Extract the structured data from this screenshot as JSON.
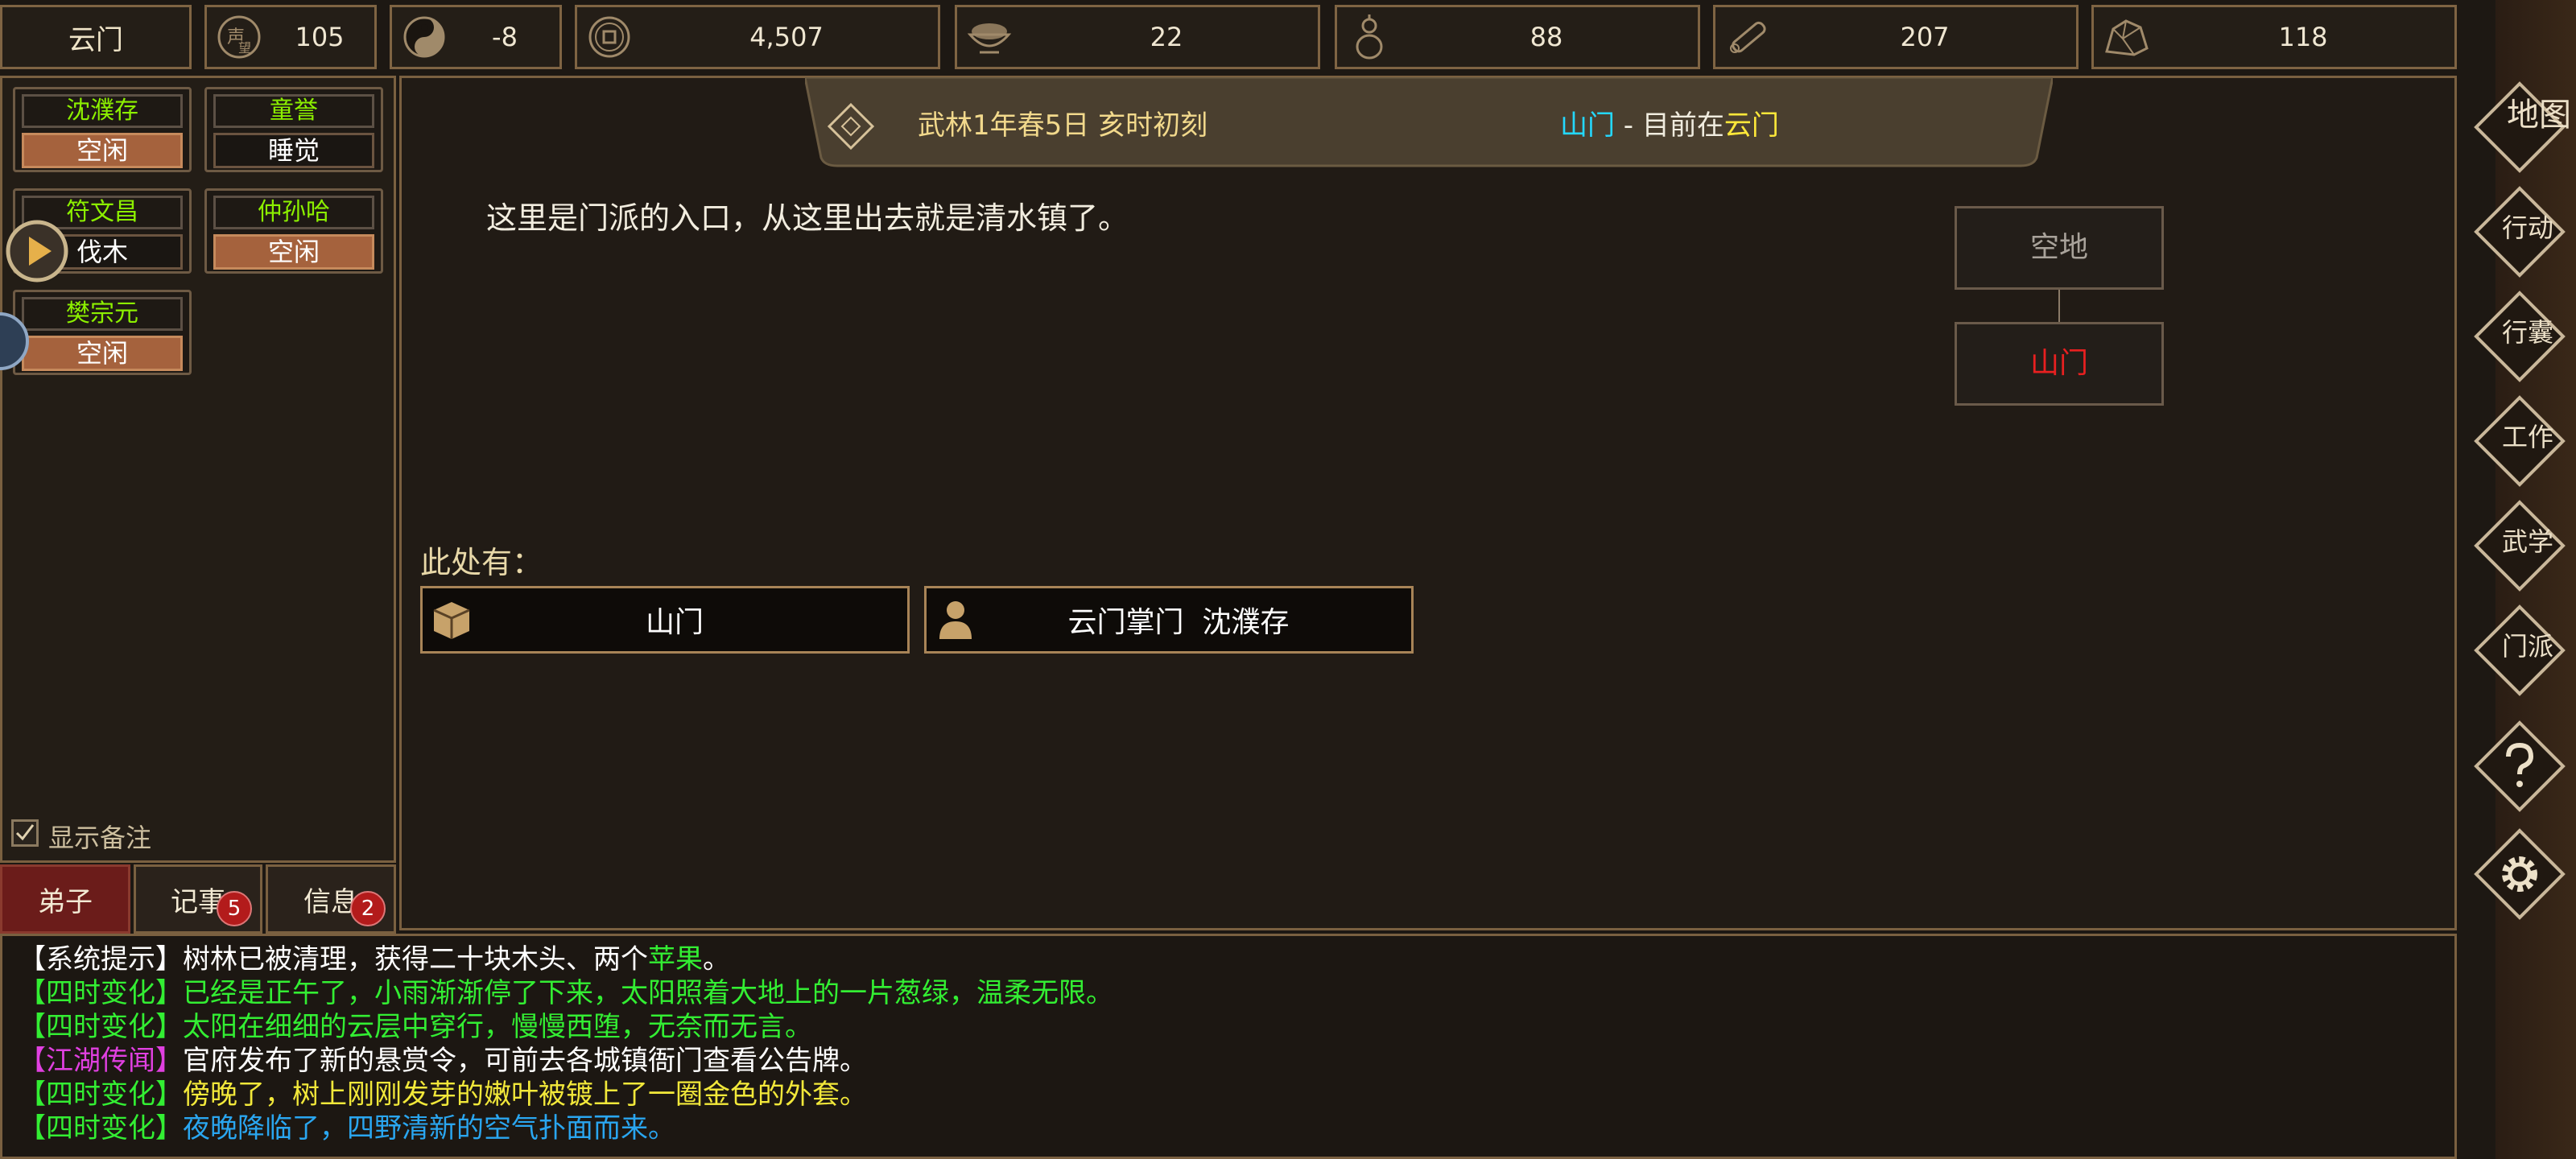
{
  "topbar": {
    "sect": "云门",
    "stats": [
      {
        "icon": "reputation-icon",
        "value": "105"
      },
      {
        "icon": "yin-yang-icon",
        "value": "-8"
      },
      {
        "icon": "coin-icon",
        "value": "4,507"
      },
      {
        "icon": "food-bowl-icon",
        "value": "22"
      },
      {
        "icon": "gourd-icon",
        "value": "88"
      },
      {
        "icon": "wood-log-icon",
        "value": "207"
      },
      {
        "icon": "ore-stone-icon",
        "value": "118"
      }
    ]
  },
  "disciples": [
    {
      "name": "沈濮存",
      "status": "空闲"
    },
    {
      "name": "童誉",
      "status": "睡觉"
    },
    {
      "name": "符文昌",
      "status": "伐木"
    },
    {
      "name": "仲孙哈",
      "status": "空闲"
    },
    {
      "name": "樊宗元",
      "status": "空闲"
    }
  ],
  "show_notes": "显示备注",
  "tabs": [
    {
      "label": "弟子"
    },
    {
      "label": "记事",
      "badge": "5"
    },
    {
      "label": "信息",
      "badge": "2"
    }
  ],
  "banner": {
    "date": "武林1年春5日 亥时初刻",
    "location_place": "山门",
    "location_sep": " - 目前在",
    "location_sect": "云门"
  },
  "description": "这里是门派的入口，从这里出去就是清水镇了。",
  "map": {
    "upper": "空地",
    "current": "山门"
  },
  "here": {
    "label": "此处有：",
    "items": [
      {
        "icon": "crate-icon",
        "label": "山门"
      },
      {
        "icon": "person-icon",
        "label": "云门掌门  沈濮存"
      }
    ]
  },
  "right_menu": [
    "地图",
    "行动",
    "行囊",
    "工作",
    "武学",
    "门派"
  ],
  "log": [
    {
      "tag": "【系统提示】",
      "text": "树林已被清理，获得二十块木头、两个",
      "highlight": "苹果",
      "tail": "。",
      "tag_color": "#ffffff",
      "text_color": "#ffffff",
      "highlight_color": "#33ee33"
    },
    {
      "tag": "【四时变化】",
      "text": "已经是正午了，小雨渐渐停了下来，太阳照着大地上的一片葱绿，温柔无限。",
      "tag_color": "#33ee33",
      "text_color": "#33ee33"
    },
    {
      "tag": "【四时变化】",
      "text": "太阳在细细的云层中穿行，慢慢西堕，无奈而无言。",
      "tag_color": "#33ee33",
      "text_color": "#33ee33"
    },
    {
      "tag": "【江湖传闻】",
      "text": "官府发布了新的悬赏令，可前去各城镇衙门查看公告牌。",
      "tag_color": "#e040e0",
      "text_color": "#ffffff"
    },
    {
      "tag": "【四时变化】",
      "text": "傍晚了，树上刚刚发芽的嫩叶被镀上了一圈金色的外套。",
      "tag_color": "#33ee33",
      "text_color": "#f2e83a"
    },
    {
      "tag": "【四时变化】",
      "text": "夜晚降临了，四野清新的空气扑面而来。",
      "tag_color": "#33ee33",
      "text_color": "#2aa6f0"
    }
  ],
  "colors": {
    "accent": "#a88457",
    "active_tab": "#6b1c1a",
    "idle_status": "#a5623d",
    "name_green": "#8cf000",
    "cyan": "#24d8ff",
    "yellow": "#ffe83a",
    "red": "#e82020"
  }
}
